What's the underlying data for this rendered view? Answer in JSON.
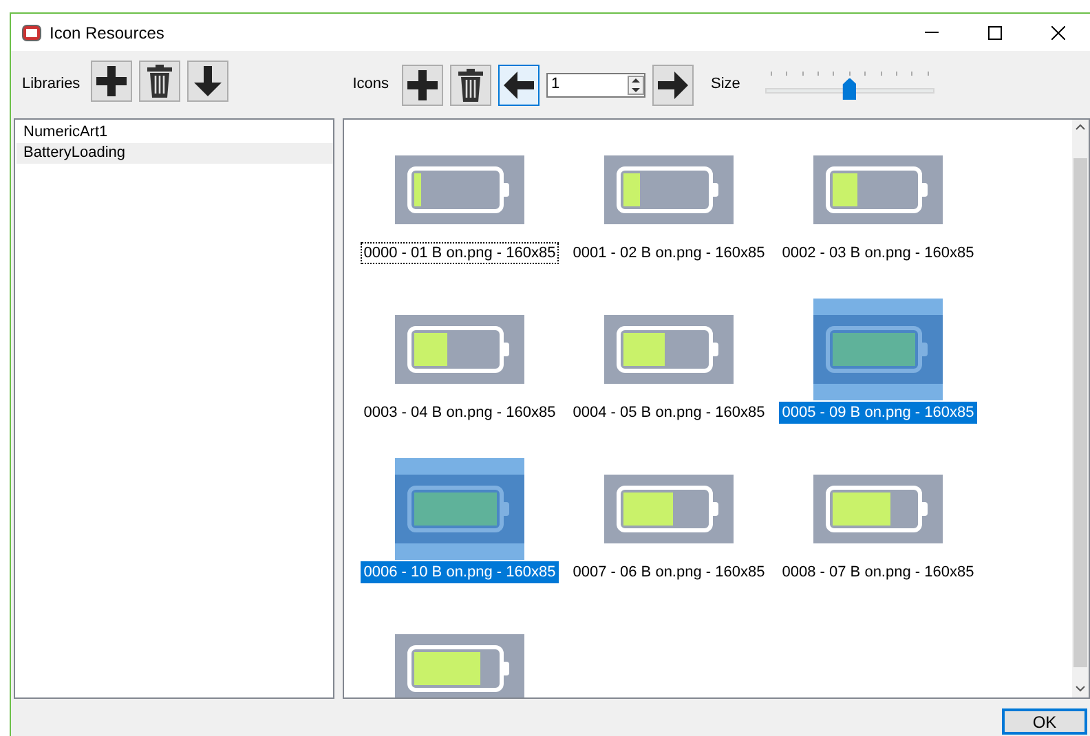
{
  "window": {
    "title": "Icon Resources"
  },
  "toolbar": {
    "libraries_label": "Libraries",
    "icons_label": "Icons",
    "page_value": "1",
    "size_label": "Size",
    "size_slider": {
      "level": 0.5
    }
  },
  "libraries": [
    {
      "label": "NumericArt1",
      "selected": false
    },
    {
      "label": "BatteryLoading",
      "selected": true
    }
  ],
  "icons": [
    {
      "label": "0000 - 01 B on.png - 160x85",
      "level": 0.08,
      "selected": false,
      "focused": true
    },
    {
      "label": "0001 - 02 B on.png - 160x85",
      "level": 0.2,
      "selected": false,
      "focused": false
    },
    {
      "label": "0002 - 03 B on.png - 160x85",
      "level": 0.3,
      "selected": false,
      "focused": false
    },
    {
      "label": "0003 - 04 B on.png - 160x85",
      "level": 0.4,
      "selected": false,
      "focused": false
    },
    {
      "label": "0004 - 05 B on.png - 160x85",
      "level": 0.5,
      "selected": false,
      "focused": false
    },
    {
      "label": "0005 - 09 B on.png - 160x85",
      "level": 1,
      "selected": true,
      "focused": false
    },
    {
      "label": "0006 - 10 B on.png - 160x85",
      "level": 1,
      "selected": true,
      "focused": false
    },
    {
      "label": "0007 - 06 B on.png - 160x85",
      "level": 0.6,
      "selected": false,
      "focused": false
    },
    {
      "label": "0008 - 07 B on.png - 160x85",
      "level": 0.7,
      "selected": false,
      "focused": false
    },
    {
      "level": 0.8,
      "selected": false
    }
  ],
  "ok_button": "OK"
}
